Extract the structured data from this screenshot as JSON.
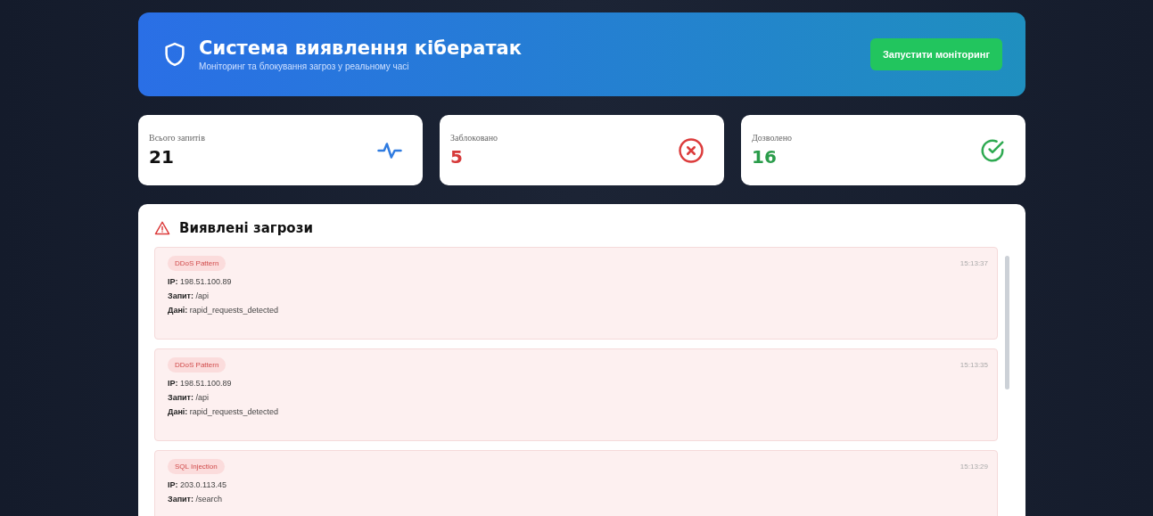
{
  "header": {
    "title": "Система виявлення кібератак",
    "subtitle": "Моніторинг та блокування загроз у реальному часі",
    "button": "Запустити моніторинг"
  },
  "stats": [
    {
      "kind": "total",
      "label": "Всього запитів",
      "value": "21"
    },
    {
      "kind": "blocked",
      "label": "Заблоковано",
      "value": "5"
    },
    {
      "kind": "allowed",
      "label": "Дозволено",
      "value": "16"
    }
  ],
  "threats_panel": {
    "title": "Виявлені загрози",
    "items": [
      {
        "type": "DDoS Pattern",
        "time": "15:13:37",
        "ip_label": "IP:",
        "ip": "198.51.100.89",
        "request_label": "Запит:",
        "request": "/api",
        "data_label": "Дані:",
        "data": "rapid_requests_detected"
      },
      {
        "type": "DDoS Pattern",
        "time": "15:13:35",
        "ip_label": "IP:",
        "ip": "198.51.100.89",
        "request_label": "Запит:",
        "request": "/api",
        "data_label": "Дані:",
        "data": "rapid_requests_detected"
      },
      {
        "type": "SQL Injection",
        "time": "15:13:29",
        "ip_label": "IP:",
        "ip": "203.0.113.45",
        "request_label": "Запит:",
        "request": "/search"
      }
    ]
  }
}
